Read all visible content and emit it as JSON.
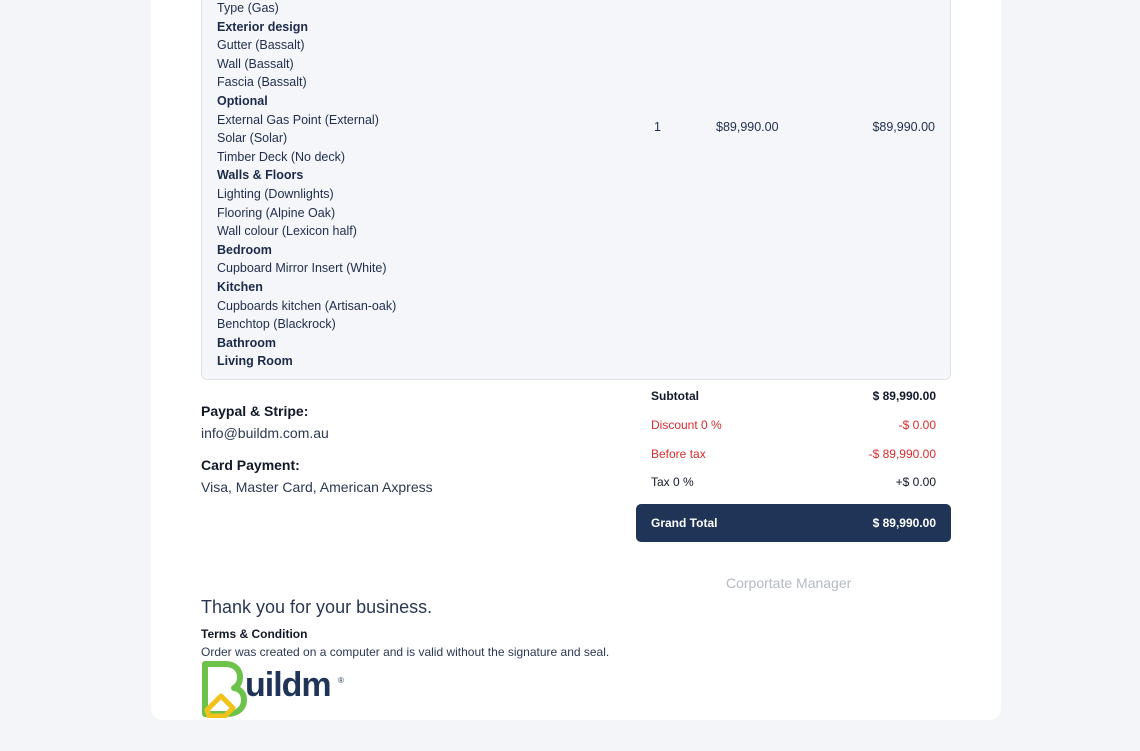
{
  "items": {
    "spec_lines": [
      {
        "text": "Type (Gas)",
        "group": false
      },
      {
        "text": "Exterior design",
        "group": true
      },
      {
        "text": "Gutter (Bassalt)",
        "group": false
      },
      {
        "text": "Wall (Bassalt)",
        "group": false
      },
      {
        "text": "Fascia (Bassalt)",
        "group": false
      },
      {
        "text": "Optional",
        "group": true
      },
      {
        "text": "External Gas Point (External)",
        "group": false
      },
      {
        "text": "Solar (Solar)",
        "group": false
      },
      {
        "text": "Timber Deck (No deck)",
        "group": false
      },
      {
        "text": "Walls & Floors",
        "group": true
      },
      {
        "text": "Lighting (Downlights)",
        "group": false
      },
      {
        "text": "Flooring (Alpine Oak)",
        "group": false
      },
      {
        "text": "Wall colour (Lexicon half)",
        "group": false
      },
      {
        "text": "Bedroom",
        "group": true
      },
      {
        "text": "Cupboard Mirror Insert (White)",
        "group": false
      },
      {
        "text": "Kitchen",
        "group": true
      },
      {
        "text": "Cupboards kitchen (Artisan-oak)",
        "group": false
      },
      {
        "text": "Benchtop (Blackrock)",
        "group": false
      },
      {
        "text": "Bathroom",
        "group": true
      },
      {
        "text": "Living Room",
        "group": true
      }
    ],
    "quantity": "1",
    "unit_price": "$89,990.00",
    "amount": "$89,990.00"
  },
  "payment": {
    "paypal_title": "Paypal & Stripe:",
    "paypal_email": "info@buildm.com.au",
    "card_title": "Card Payment:",
    "card_types": "Visa, Master Card, American Axpress"
  },
  "totals": {
    "subtotal_label": "Subtotal",
    "subtotal_value": "$ 89,990.00",
    "discount_label": "Discount 0 %",
    "discount_value": "-$ 0.00",
    "before_tax_label": "Before tax",
    "before_tax_value": "-$ 89,990.00",
    "tax_label": "Tax 0 %",
    "tax_value": "+$ 0.00",
    "grand_label": "Grand Total",
    "grand_value": "$ 89,990.00"
  },
  "signature": {
    "manager_label": "Corportate Manager"
  },
  "footer": {
    "thanks": "Thank you for your business.",
    "terms_title": "Terms & Condition",
    "terms_text": "Order was created on a computer and is valid without the signature and seal."
  },
  "brand": {
    "logo_text": "uildm",
    "logo_mark": "B",
    "reg_mark": "®",
    "colors": {
      "navy": "#1f3456",
      "red": "#d92d2d",
      "logo_green": "#6cc24a",
      "logo_yellow": "#f2c21b"
    }
  }
}
